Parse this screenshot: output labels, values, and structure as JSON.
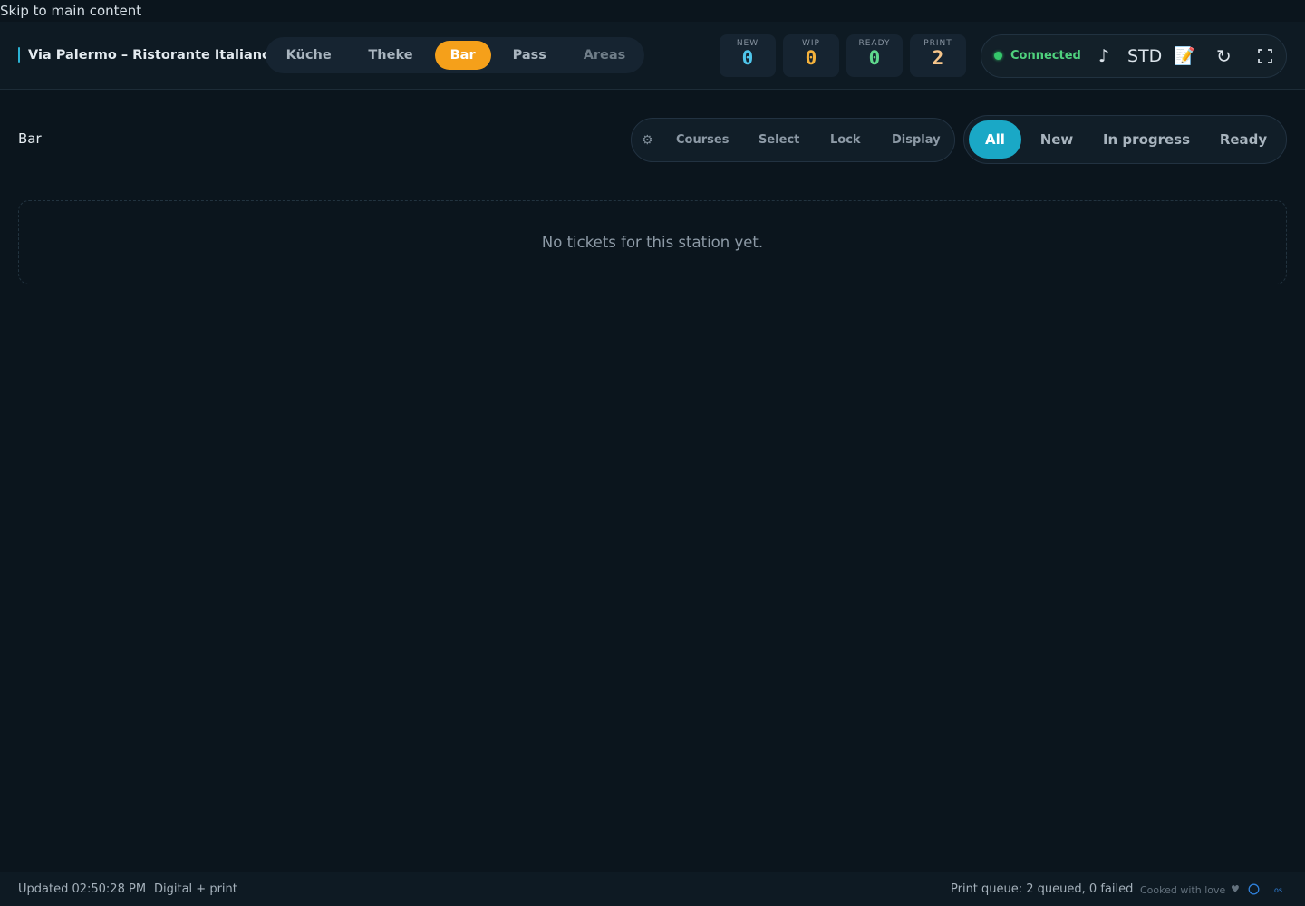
{
  "skip_link": "Skip to main content",
  "header": {
    "brand_title": "Via Palermo – Ristorante Italiano",
    "station_tabs": [
      {
        "label": "Küche",
        "active": false
      },
      {
        "label": "Theke",
        "active": false
      },
      {
        "label": "Bar",
        "active": true
      },
      {
        "label": "Pass",
        "active": false
      },
      {
        "label": "Areas",
        "active": false
      }
    ],
    "counters": [
      {
        "label": "NEW",
        "value": "0",
        "color": "#4fc6ec"
      },
      {
        "label": "WIP",
        "value": "0",
        "color": "#f5b23b"
      },
      {
        "label": "READY",
        "value": "0",
        "color": "#5fd98d"
      },
      {
        "label": "PRINT",
        "value": "2",
        "color": "#f6c58a"
      }
    ],
    "status": {
      "connection": "Connected",
      "connection_color": "#35c76b",
      "sound_icon": "♪",
      "mode": "STD",
      "notes_icon": "📝",
      "refresh_icon": "↻"
    }
  },
  "main": {
    "title": "Bar",
    "tools": {
      "gear_icon": "⚙",
      "items": [
        "Courses",
        "Select",
        "Lock",
        "Display"
      ]
    },
    "filters": [
      {
        "label": "All",
        "active": true
      },
      {
        "label": "New",
        "active": false
      },
      {
        "label": "In progress",
        "active": false
      },
      {
        "label": "Ready",
        "active": false
      }
    ],
    "empty_message": "No tickets for this station yet."
  },
  "footer": {
    "updated": "Updated 02:50:28 PM",
    "mode": "Digital + print",
    "print_queue": "Print queue: 2 queued, 0 failed",
    "credit": "Cooked with love",
    "heart": "♥",
    "os_label": "os"
  },
  "colors": {
    "accent_station": "#f5a01a",
    "accent_filter": "#1aa8c6",
    "background": "#0b151d"
  }
}
